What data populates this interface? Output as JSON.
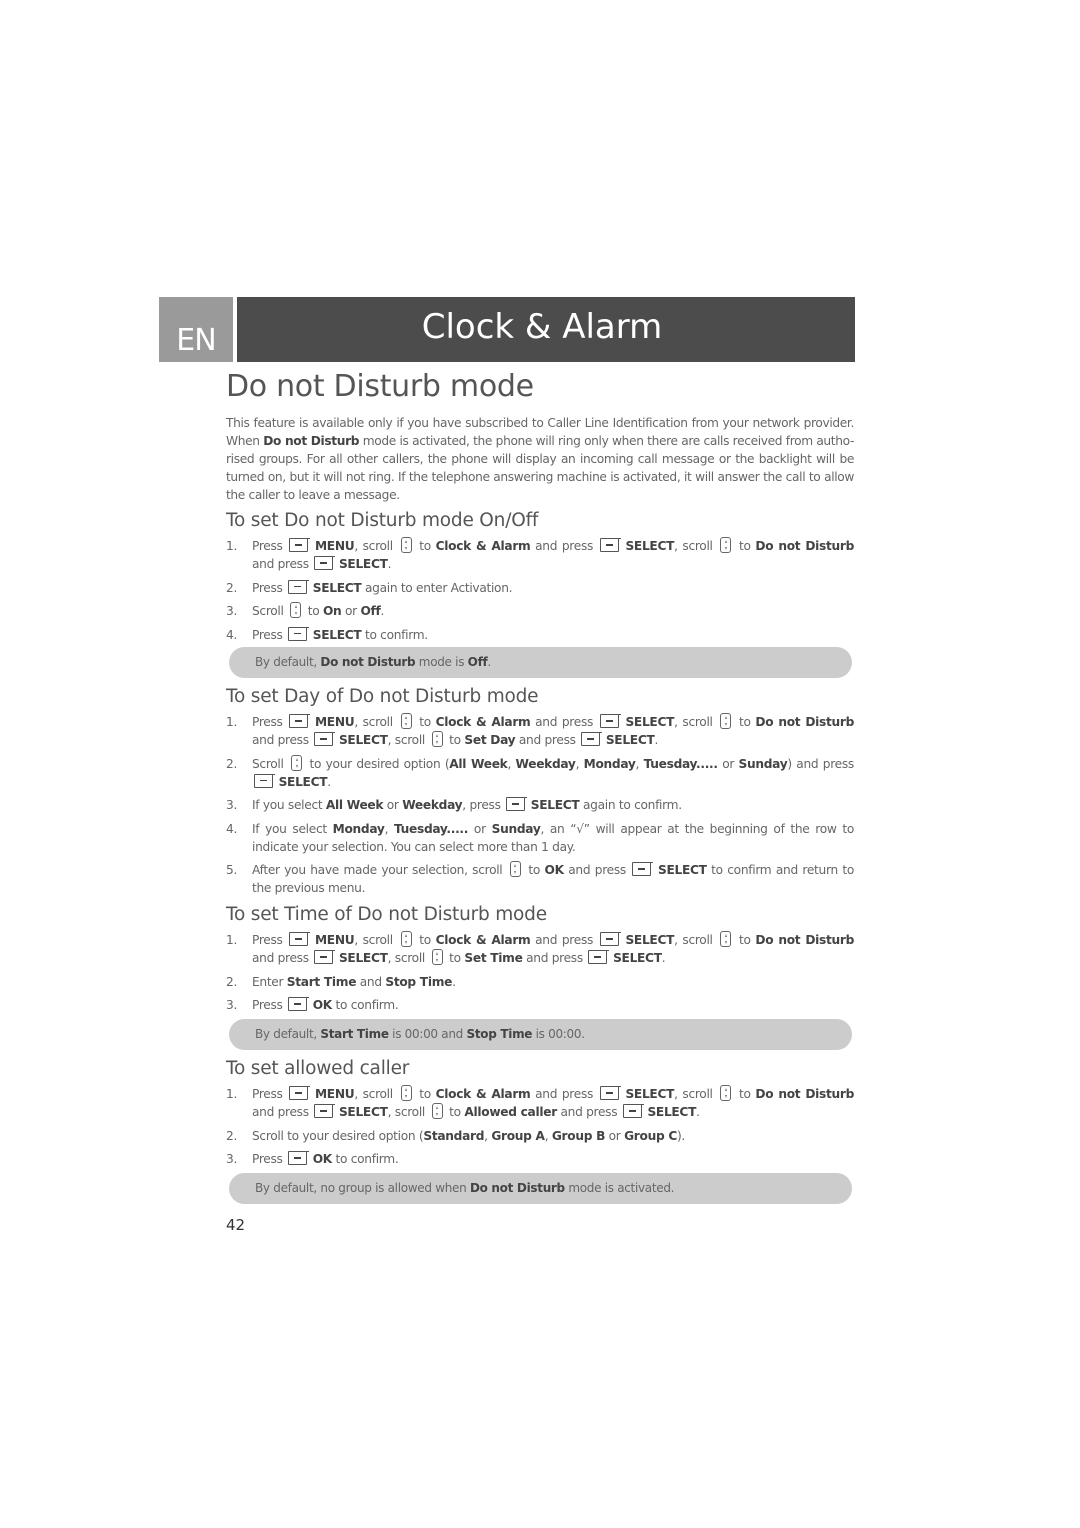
{
  "header": {
    "language": "EN",
    "chapter_title": "Clock & Alarm"
  },
  "page_title": "Do not Disturb mode",
  "intro": {
    "p1": "This feature is available only if you have subscribed to Caller Line Identification from your network provider. When ",
    "b1": "Do not Disturb",
    "p2": " mode is activated, the phone will ring only when there are calls received from autho-rised groups. For all other callers, the phone will display an incoming call message or the backlight will be turned on, but it will not ring. If the telephone answering machine is activated, it will answer the call to allow the caller to leave a message."
  },
  "terms": {
    "press": "Press",
    "press_lc": "press",
    "scroll_lc": "scroll",
    "scroll": "Scroll",
    "to": "to",
    "and_press": "and press",
    "and": "and",
    "menu": "MENU",
    "select": "SELECT",
    "ok": "OK",
    "clock_alarm": "Clock & Alarm",
    "dnd": "Do not Disturb",
    "comma": ",",
    "period": "."
  },
  "icons": {
    "softkey": "softkey-icon",
    "navigation": "navigation-key-icon"
  },
  "sections": [
    {
      "title": "To set Do not Disturb mode On/Off",
      "steps": [
        {
          "num": "1."
        },
        {
          "num": "2.",
          "text": "again to enter Activation."
        },
        {
          "num": "3.",
          "on": "On",
          "or": "or",
          "off": "Off"
        },
        {
          "num": "4.",
          "text": "to confirm."
        }
      ],
      "note": {
        "pre": "By default, ",
        "b1": "Do not Disturb",
        "mid": " mode is ",
        "b2": "Off",
        "post": "."
      }
    },
    {
      "title": "To set Day of Do not Disturb mode",
      "steps": [
        {
          "num": "1.",
          "target": "Set Day"
        },
        {
          "num": "2.",
          "pre": "to your desired option (",
          "o1": "All Week",
          "o2": "Weekday",
          "o3": "Monday",
          "o4": "Tuesday.....",
          "or": "or",
          "o5": "Sunday",
          "post": ") and press"
        },
        {
          "num": "3.",
          "pre": "If you select ",
          "b1": "All Week",
          "or": " or ",
          "b2": "Weekday",
          "mid": ", press",
          "post": "again to confirm."
        },
        {
          "num": "4.",
          "pre": "If you select ",
          "b1": "Monday",
          "b2": "Tuesday.....",
          "or": " or ",
          "b3": "Sunday",
          "post": ", an “√” will appear at the beginning of the row to indicate your selection. You can select more than 1 day."
        },
        {
          "num": "5.",
          "pre": "After you have made your selection, scroll",
          "post": "to confirm and return to the previous menu."
        }
      ]
    },
    {
      "title": "To set Time of Do not Disturb mode",
      "steps": [
        {
          "num": "1.",
          "target": "Set Time"
        },
        {
          "num": "2.",
          "pre": "Enter ",
          "b1": "Start Time",
          "b2": "Stop Time"
        },
        {
          "num": "3.",
          "text": "to confirm."
        }
      ],
      "note": {
        "pre": "By default, ",
        "b1": "Start Time",
        "is1": " is 00:00 and ",
        "b2": "Stop Time",
        "is2": " is 00:00."
      }
    },
    {
      "title": "To set allowed caller",
      "steps": [
        {
          "num": "1.",
          "target": "Allowed caller"
        },
        {
          "num": "2.",
          "pre": "Scroll to your desired option (",
          "o1": "Standard",
          "o2": "Group A",
          "o3": "Group B",
          "or": " or ",
          "o4": "Group C",
          "post": ")."
        },
        {
          "num": "3.",
          "text": "to confirm."
        }
      ],
      "note": {
        "pre": "By default, no group is allowed when ",
        "b1": "Do not Disturb",
        "post": " mode is activated."
      }
    }
  ],
  "page_number": "42"
}
